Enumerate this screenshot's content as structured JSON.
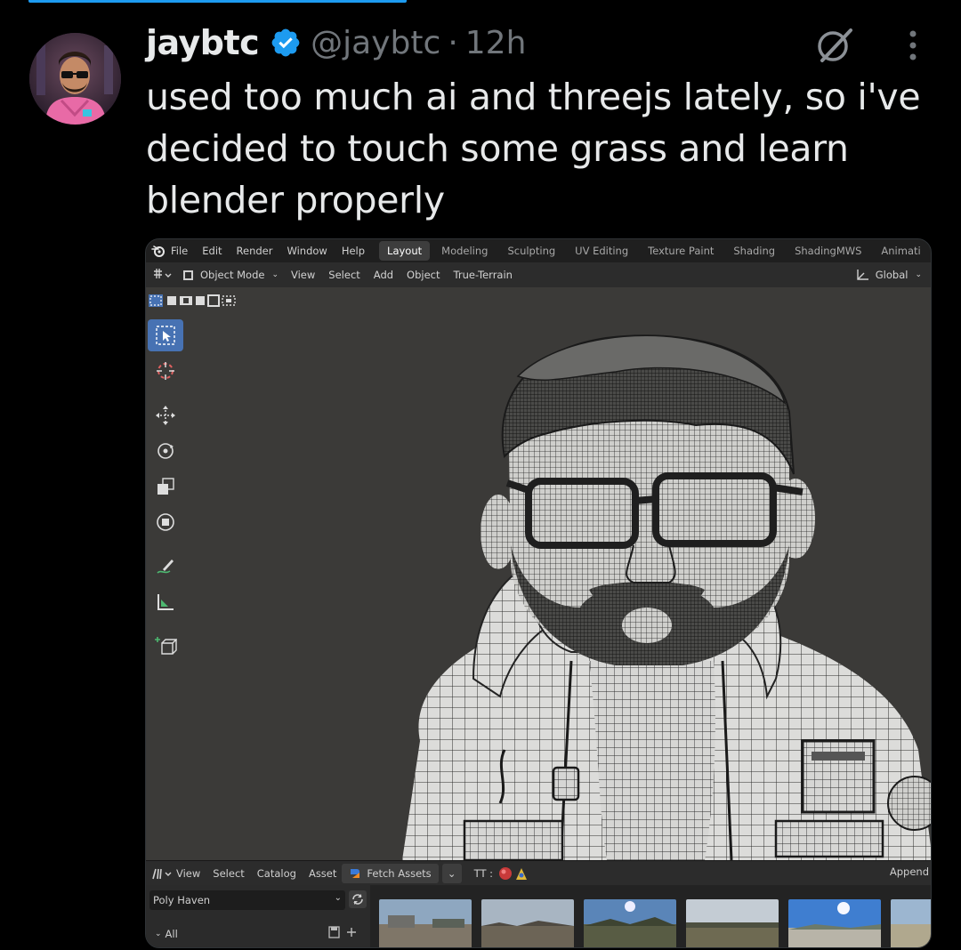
{
  "tweet": {
    "display_name": "jaybtc",
    "handle": "@jaybtc",
    "separator": "·",
    "time": "12h",
    "text": "used too much ai and threejs lately, so i've decided to touch some grass and learn blender properly"
  },
  "blender": {
    "menu": [
      "File",
      "Edit",
      "Render",
      "Window",
      "Help"
    ],
    "workspaces": [
      "Layout",
      "Modeling",
      "Sculpting",
      "UV Editing",
      "Texture Paint",
      "Shading",
      "ShadingMWS",
      "Animati"
    ],
    "active_workspace": "Layout",
    "header": {
      "mode": "Object Mode",
      "items": [
        "View",
        "Select",
        "Add",
        "Object",
        "True-Terrain"
      ],
      "orientation": "Global"
    },
    "asset_browser": {
      "items": [
        "View",
        "Select",
        "Catalog",
        "Asset"
      ],
      "fetch_label": "Fetch Assets",
      "tt_label": "TT :",
      "append_label": "Append",
      "library": "Poly Haven",
      "catalog": "All"
    }
  },
  "colors": {
    "accent": "#1d9bf0",
    "blender_active": "#4772b3",
    "viewport_bg": "#3b3a38"
  },
  "icons": [
    "verified-badge-icon",
    "grok-icon",
    "more-icon",
    "blender-logo-icon",
    "select-box-icon",
    "cursor-icon",
    "move-icon",
    "rotate-icon",
    "scale-icon",
    "transform-icon",
    "annotate-icon",
    "measure-icon",
    "add-cube-icon"
  ]
}
